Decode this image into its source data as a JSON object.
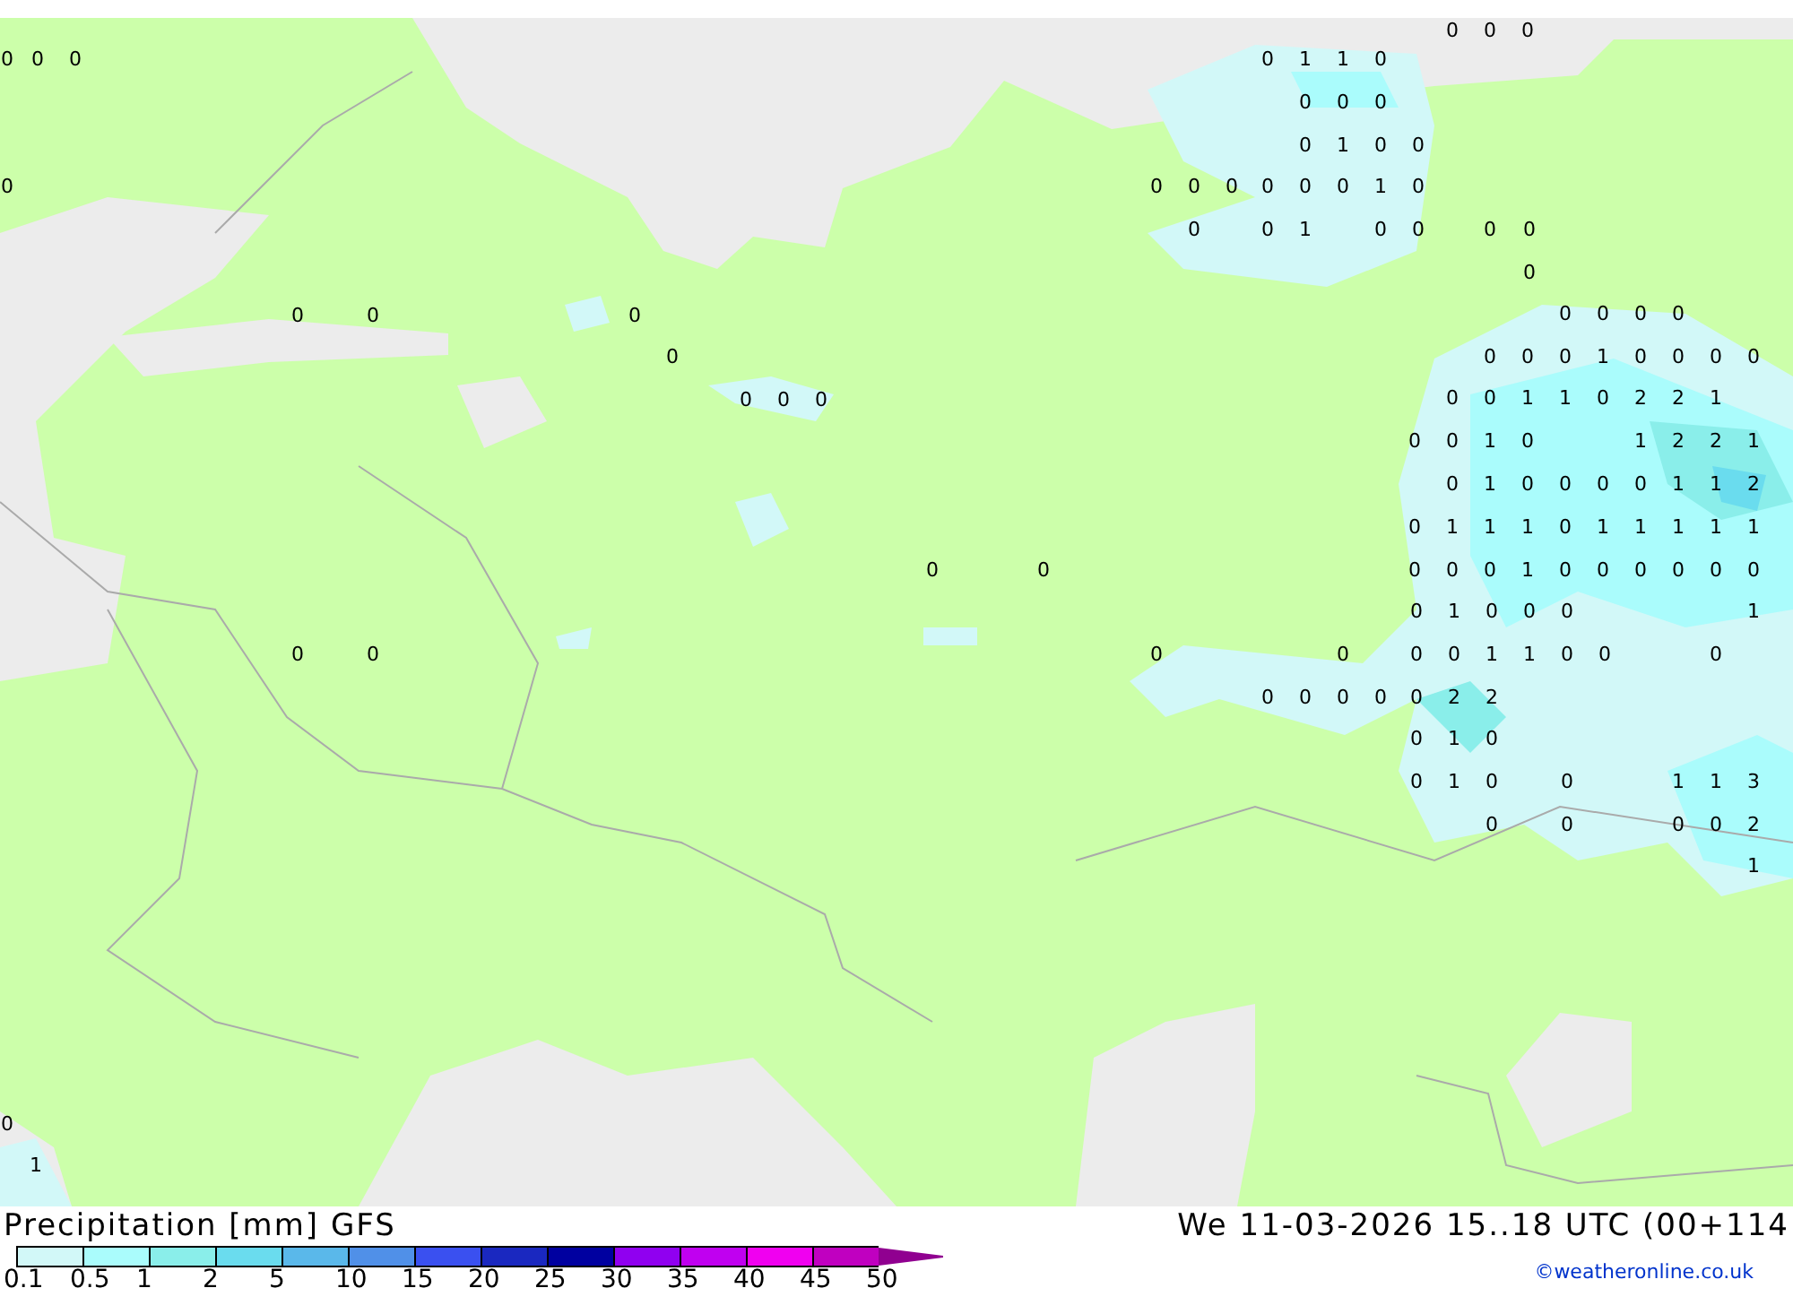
{
  "map": {
    "labels": [
      "0",
      "0",
      "0",
      "0",
      "0",
      "0",
      "0",
      "1",
      "0",
      "0",
      "0",
      "0",
      "0",
      "0",
      "1",
      "1",
      "0",
      "2",
      "2",
      "1",
      "0",
      "0",
      "1",
      "0",
      "1",
      "2",
      "2",
      "1",
      "0",
      "1",
      "0",
      "0",
      "0",
      "0",
      "1",
      "1",
      "2",
      "0",
      "1",
      "1",
      "1",
      "0",
      "1",
      "1",
      "1",
      "1",
      "1",
      "0",
      "0",
      "0",
      "1",
      "0",
      "0",
      "0",
      "0",
      "0",
      "0",
      "0",
      "1",
      "0",
      "0",
      "0",
      "1",
      "0",
      "0",
      "0",
      "0",
      "1",
      "1",
      "0",
      "0",
      "0",
      "0",
      "0",
      "0",
      "0",
      "0",
      "2",
      "2",
      "0",
      "1",
      "0",
      "0",
      "1",
      "0",
      "0",
      "1",
      "1",
      "3",
      "0",
      "0",
      "0",
      "0",
      "2",
      "1",
      "0",
      "0",
      "0",
      "0",
      "1",
      "1",
      "0",
      "0",
      "0",
      "0",
      "0",
      "1",
      "0",
      "0",
      "0",
      "0",
      "0",
      "0",
      "0",
      "0",
      "1",
      "0",
      "0",
      "0",
      "1",
      "0",
      "0",
      "0",
      "0",
      "0",
      "0",
      "0",
      "0",
      "0",
      "0",
      "0",
      "0",
      "0",
      "0",
      "0",
      "0",
      "0",
      "0",
      "0",
      "0",
      "0",
      "1"
    ]
  },
  "footer": {
    "title": "Precipitation [mm] GFS",
    "date": "We 11-03-2026 15..18 UTC (00+114",
    "credit": "©weatheronline.co.uk"
  },
  "legend": [
    {
      "label": "0.1",
      "color": "#d2f8f8"
    },
    {
      "label": "0.5",
      "color": "#aafcfc"
    },
    {
      "label": "1",
      "color": "#8aeeea"
    },
    {
      "label": "2",
      "color": "#6adcee"
    },
    {
      "label": "5",
      "color": "#5ab8ea"
    },
    {
      "label": "10",
      "color": "#5090e8"
    },
    {
      "label": "15",
      "color": "#3a50f0"
    },
    {
      "label": "20",
      "color": "#1a28c0"
    },
    {
      "label": "25",
      "color": "#0000a0"
    },
    {
      "label": "30",
      "color": "#9000f0"
    },
    {
      "label": "35",
      "color": "#c000f0"
    },
    {
      "label": "40",
      "color": "#f000f0"
    },
    {
      "label": "45",
      "color": "#c000c0"
    },
    {
      "label": "50",
      "color": "#900090"
    }
  ]
}
